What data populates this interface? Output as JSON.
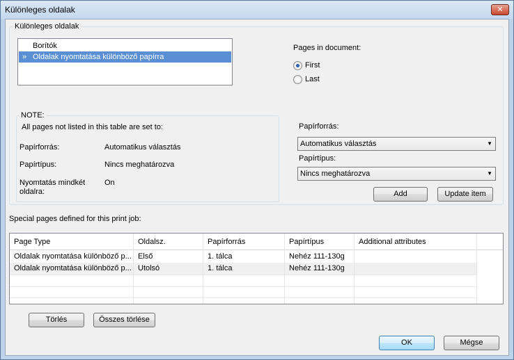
{
  "window": {
    "title": "Különleges oldalak",
    "close_label": "✕"
  },
  "group_top": {
    "legend": "Különleges oldalak",
    "list_items": [
      {
        "label": "Borítók",
        "selected": false,
        "mark": ""
      },
      {
        "label": "Oldalak nyomtatása különböző papírra",
        "selected": true,
        "mark": "»"
      }
    ]
  },
  "pages_in_document": {
    "label": "Pages in document:",
    "options": [
      {
        "label": "First",
        "checked": true
      },
      {
        "label": "Last",
        "checked": false
      }
    ]
  },
  "note": {
    "legend": "NOTE:",
    "intro": "All pages not listed in this table are set to:",
    "rows": [
      {
        "key": "Papírforrás:",
        "value": "Automatikus választás"
      },
      {
        "key": "Papírtípus:",
        "value": "Nincs meghatározva"
      },
      {
        "key": "Nyomtatás mindkét oldalra:",
        "value": "On"
      }
    ]
  },
  "settings": {
    "paper_source_label": "Papírforrás:",
    "paper_source_value": "Automatikus választás",
    "paper_type_label": "Papírtípus:",
    "paper_type_value": "Nincs meghatározva",
    "add_label": "Add",
    "update_label": "Update item"
  },
  "special_pages": {
    "label": "Special pages defined for this print job:",
    "columns": [
      "Page Type",
      "Oldalsz.",
      "Papírforrás",
      "Papírtípus",
      "Additional attributes"
    ],
    "rows": [
      [
        "Oldalak nyomtatása különböző p...",
        "Első",
        "1. tálca",
        "Nehéz 111-130g",
        ""
      ],
      [
        "Oldalak nyomtatása különböző p...",
        "Utolsó",
        "1. tálca",
        "Nehéz 111-130g",
        ""
      ]
    ],
    "delete_label": "Törlés",
    "delete_all_label": "Összes törlése"
  },
  "footer": {
    "ok_label": "OK",
    "cancel_label": "Mégse"
  }
}
